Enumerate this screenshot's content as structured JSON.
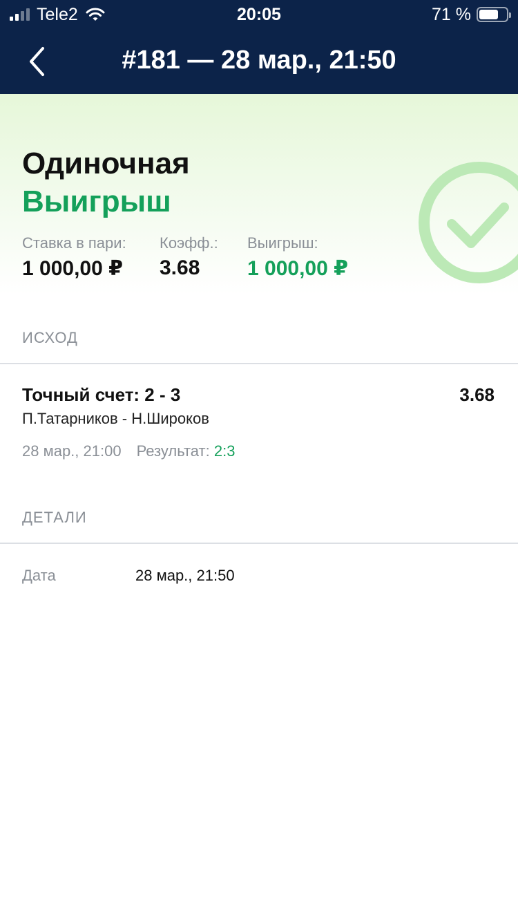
{
  "status_bar": {
    "carrier": "Tele2",
    "time": "20:05",
    "battery_percent": "71 %",
    "battery_level": 0.71
  },
  "nav": {
    "back_icon": "chevron-left-icon",
    "title": "#181 — 28 мар., 21:50"
  },
  "bet": {
    "type": "Одиночная",
    "status": "Выигрыш",
    "status_icon": "check-circle-icon",
    "stake_label": "Ставка в пари:",
    "stake_value": "1 000,00 ₽",
    "odds_label": "Коэфф.:",
    "odds_value": "3.68",
    "win_label": "Выигрыш:",
    "win_value": "1 000,00 ₽"
  },
  "outcome": {
    "section_title": "ИСХОД",
    "name": "Точный счет: 2 - 3",
    "odds": "3.68",
    "event": "П.Татарников - Н.Широков",
    "datetime": "28 мар., 21:00",
    "result_label": "Результат:",
    "result_value": "2:3"
  },
  "details": {
    "section_title": "ДЕТАЛИ",
    "date_label": "Дата",
    "date_value": "28 мар., 21:50"
  },
  "colors": {
    "header_bg": "#0c2349",
    "win_green": "#14a05a",
    "muted_text": "#8a8f96",
    "hero_bg": "#e6f7d9"
  }
}
